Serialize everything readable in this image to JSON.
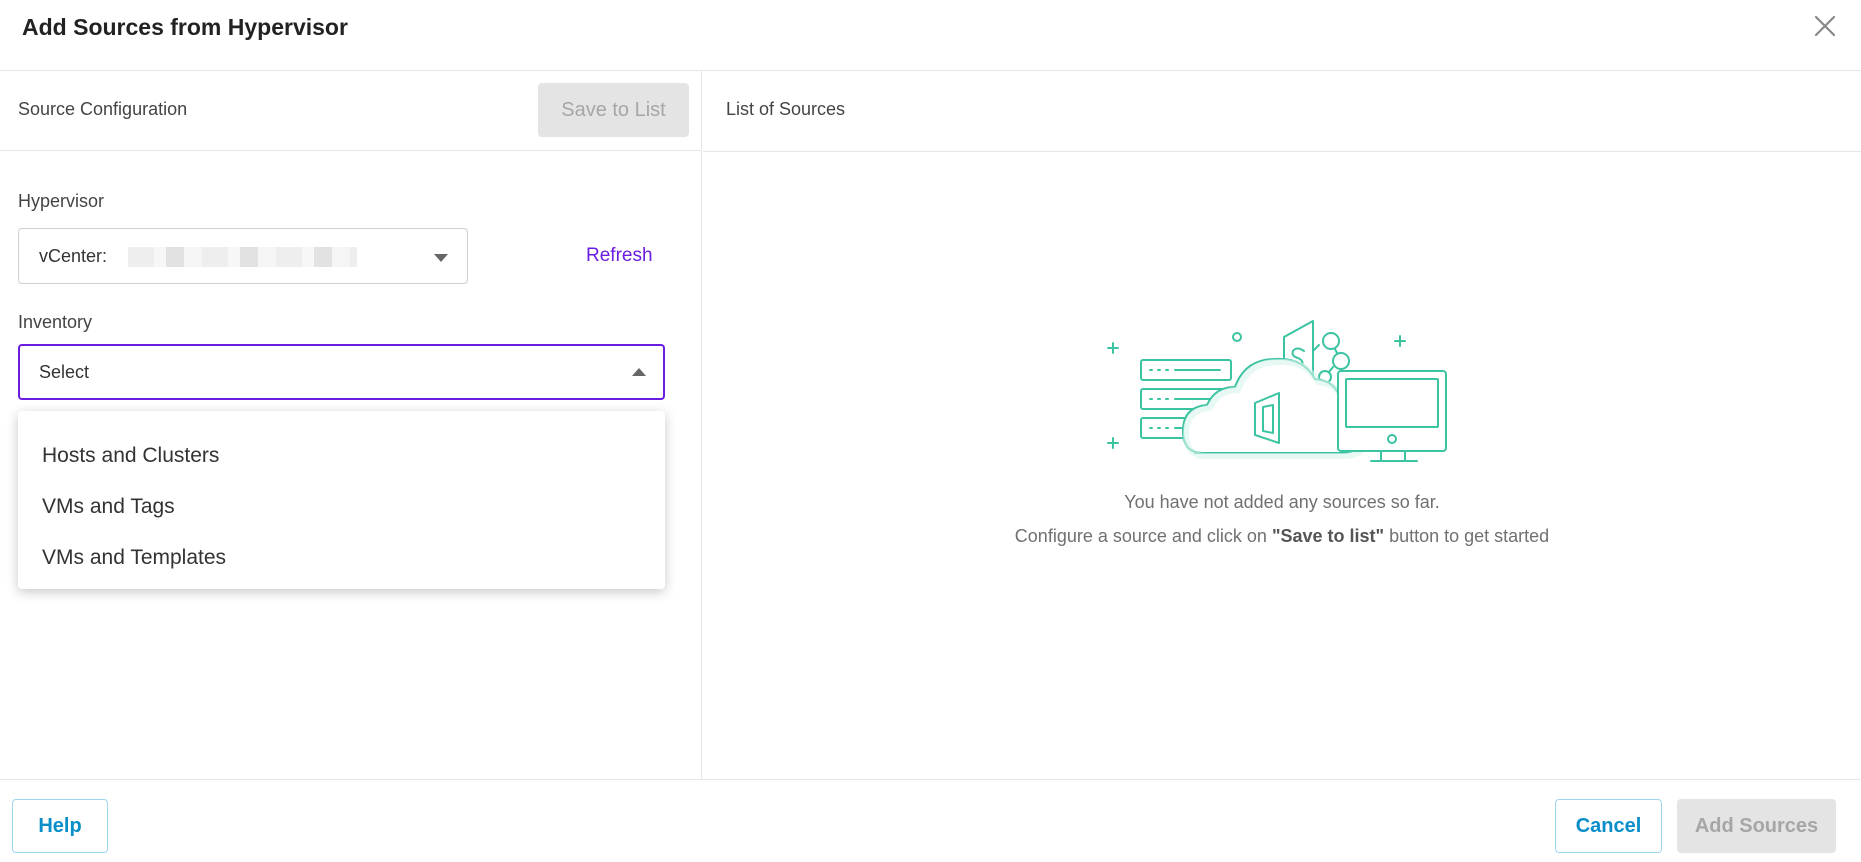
{
  "dialog": {
    "title": "Add Sources from Hypervisor"
  },
  "left": {
    "section_title": "Source Configuration",
    "save_label": "Save to List",
    "hypervisor": {
      "label": "Hypervisor",
      "value": "vCenter:"
    },
    "refresh_label": "Refresh",
    "inventory": {
      "label": "Inventory",
      "placeholder": "Select",
      "options": [
        "Hosts and Clusters",
        "VMs and Tags",
        "VMs and Templates"
      ]
    }
  },
  "right": {
    "section_title": "List of Sources",
    "empty_line1": "You have not added any sources so far.",
    "empty_prefix": "Configure a source and click on ",
    "empty_bold": "\"Save to list\"",
    "empty_suffix": " button to get started"
  },
  "footer": {
    "help_label": "Help",
    "cancel_label": "Cancel",
    "add_label": "Add Sources"
  },
  "colors": {
    "accent_purple": "#6a1de0",
    "link_blue": "#0a8ec9",
    "illustration_green": "#3cc3a2"
  }
}
